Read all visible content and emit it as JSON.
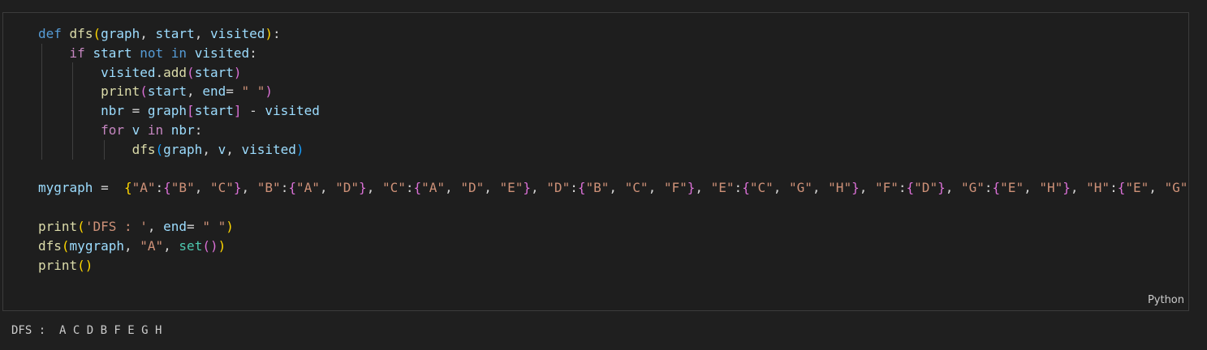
{
  "cell": {
    "language_label": "Python",
    "code_lines": [
      [
        [
          "kw",
          "def"
        ],
        [
          "op",
          " "
        ],
        [
          "fn",
          "dfs"
        ],
        [
          "b1",
          "("
        ],
        [
          "var",
          "graph"
        ],
        [
          "op",
          ", "
        ],
        [
          "var",
          "start"
        ],
        [
          "op",
          ", "
        ],
        [
          "var",
          "visited"
        ],
        [
          "b1",
          ")"
        ],
        [
          "op",
          ":"
        ]
      ],
      [
        [
          "op",
          "    "
        ],
        [
          "kw2",
          "if"
        ],
        [
          "op",
          " "
        ],
        [
          "var",
          "start"
        ],
        [
          "op",
          " "
        ],
        [
          "kw",
          "not"
        ],
        [
          "op",
          " "
        ],
        [
          "kw",
          "in"
        ],
        [
          "op",
          " "
        ],
        [
          "var",
          "visited"
        ],
        [
          "op",
          ":"
        ]
      ],
      [
        [
          "op",
          "        "
        ],
        [
          "var",
          "visited"
        ],
        [
          "op",
          "."
        ],
        [
          "fn",
          "add"
        ],
        [
          "b2",
          "("
        ],
        [
          "var",
          "start"
        ],
        [
          "b2",
          ")"
        ]
      ],
      [
        [
          "op",
          "        "
        ],
        [
          "fn",
          "print"
        ],
        [
          "b2",
          "("
        ],
        [
          "var",
          "start"
        ],
        [
          "op",
          ", "
        ],
        [
          "var",
          "end"
        ],
        [
          "op",
          "= "
        ],
        [
          "str",
          "\" \""
        ],
        [
          "b2",
          ")"
        ]
      ],
      [
        [
          "op",
          "        "
        ],
        [
          "var",
          "nbr"
        ],
        [
          "op",
          " = "
        ],
        [
          "var",
          "graph"
        ],
        [
          "b2",
          "["
        ],
        [
          "var",
          "start"
        ],
        [
          "b2",
          "]"
        ],
        [
          "op",
          " - "
        ],
        [
          "var",
          "visited"
        ]
      ],
      [
        [
          "op",
          "        "
        ],
        [
          "kw2",
          "for"
        ],
        [
          "op",
          " "
        ],
        [
          "var",
          "v"
        ],
        [
          "op",
          " "
        ],
        [
          "kw2",
          "in"
        ],
        [
          "op",
          " "
        ],
        [
          "var",
          "nbr"
        ],
        [
          "op",
          ":"
        ]
      ],
      [
        [
          "op",
          "            "
        ],
        [
          "fn",
          "dfs"
        ],
        [
          "b3",
          "("
        ],
        [
          "var",
          "graph"
        ],
        [
          "op",
          ", "
        ],
        [
          "var",
          "v"
        ],
        [
          "op",
          ", "
        ],
        [
          "var",
          "visited"
        ],
        [
          "b3",
          ")"
        ]
      ],
      [
        [
          "op",
          " "
        ]
      ],
      [
        [
          "var",
          "mygraph"
        ],
        [
          "op",
          " =  "
        ],
        [
          "b1",
          "{"
        ],
        [
          "str",
          "\"A\""
        ],
        [
          "op",
          ":"
        ],
        [
          "b2",
          "{"
        ],
        [
          "str",
          "\"B\""
        ],
        [
          "op",
          ", "
        ],
        [
          "str",
          "\"C\""
        ],
        [
          "b2",
          "}"
        ],
        [
          "op",
          ", "
        ],
        [
          "str",
          "\"B\""
        ],
        [
          "op",
          ":"
        ],
        [
          "b2",
          "{"
        ],
        [
          "str",
          "\"A\""
        ],
        [
          "op",
          ", "
        ],
        [
          "str",
          "\"D\""
        ],
        [
          "b2",
          "}"
        ],
        [
          "op",
          ", "
        ],
        [
          "str",
          "\"C\""
        ],
        [
          "op",
          ":"
        ],
        [
          "b2",
          "{"
        ],
        [
          "str",
          "\"A\""
        ],
        [
          "op",
          ", "
        ],
        [
          "str",
          "\"D\""
        ],
        [
          "op",
          ", "
        ],
        [
          "str",
          "\"E\""
        ],
        [
          "b2",
          "}"
        ],
        [
          "op",
          ", "
        ],
        [
          "str",
          "\"D\""
        ],
        [
          "op",
          ":"
        ],
        [
          "b2",
          "{"
        ],
        [
          "str",
          "\"B\""
        ],
        [
          "op",
          ", "
        ],
        [
          "str",
          "\"C\""
        ],
        [
          "op",
          ", "
        ],
        [
          "str",
          "\"F\""
        ],
        [
          "b2",
          "}"
        ],
        [
          "op",
          ", "
        ],
        [
          "str",
          "\"E\""
        ],
        [
          "op",
          ":"
        ],
        [
          "b2",
          "{"
        ],
        [
          "str",
          "\"C\""
        ],
        [
          "op",
          ", "
        ],
        [
          "str",
          "\"G\""
        ],
        [
          "op",
          ", "
        ],
        [
          "str",
          "\"H\""
        ],
        [
          "b2",
          "}"
        ],
        [
          "op",
          ", "
        ],
        [
          "str",
          "\"F\""
        ],
        [
          "op",
          ":"
        ],
        [
          "b2",
          "{"
        ],
        [
          "str",
          "\"D\""
        ],
        [
          "b2",
          "}"
        ],
        [
          "op",
          ", "
        ],
        [
          "str",
          "\"G\""
        ],
        [
          "op",
          ":"
        ],
        [
          "b2",
          "{"
        ],
        [
          "str",
          "\"E\""
        ],
        [
          "op",
          ", "
        ],
        [
          "str",
          "\"H\""
        ],
        [
          "b2",
          "}"
        ],
        [
          "op",
          ", "
        ],
        [
          "str",
          "\"H\""
        ],
        [
          "op",
          ":"
        ],
        [
          "b2",
          "{"
        ],
        [
          "str",
          "\"E\""
        ],
        [
          "op",
          ", "
        ],
        [
          "str",
          "\"G\""
        ],
        [
          "b2",
          "}"
        ]
      ],
      [
        [
          "op",
          " "
        ]
      ],
      [
        [
          "fn",
          "print"
        ],
        [
          "b1",
          "("
        ],
        [
          "str",
          "'DFS : '"
        ],
        [
          "op",
          ", "
        ],
        [
          "var",
          "end"
        ],
        [
          "op",
          "= "
        ],
        [
          "str",
          "\" \""
        ],
        [
          "b1",
          ")"
        ]
      ],
      [
        [
          "fn",
          "dfs"
        ],
        [
          "b1",
          "("
        ],
        [
          "var",
          "mygraph"
        ],
        [
          "op",
          ", "
        ],
        [
          "str",
          "\"A\""
        ],
        [
          "op",
          ", "
        ],
        [
          "bi",
          "set"
        ],
        [
          "b2",
          "()"
        ],
        [
          "b1",
          ")"
        ]
      ],
      [
        [
          "fn",
          "print"
        ],
        [
          "b1",
          "()"
        ]
      ]
    ]
  },
  "output": {
    "text": "DFS :  A C D B F E G H"
  }
}
